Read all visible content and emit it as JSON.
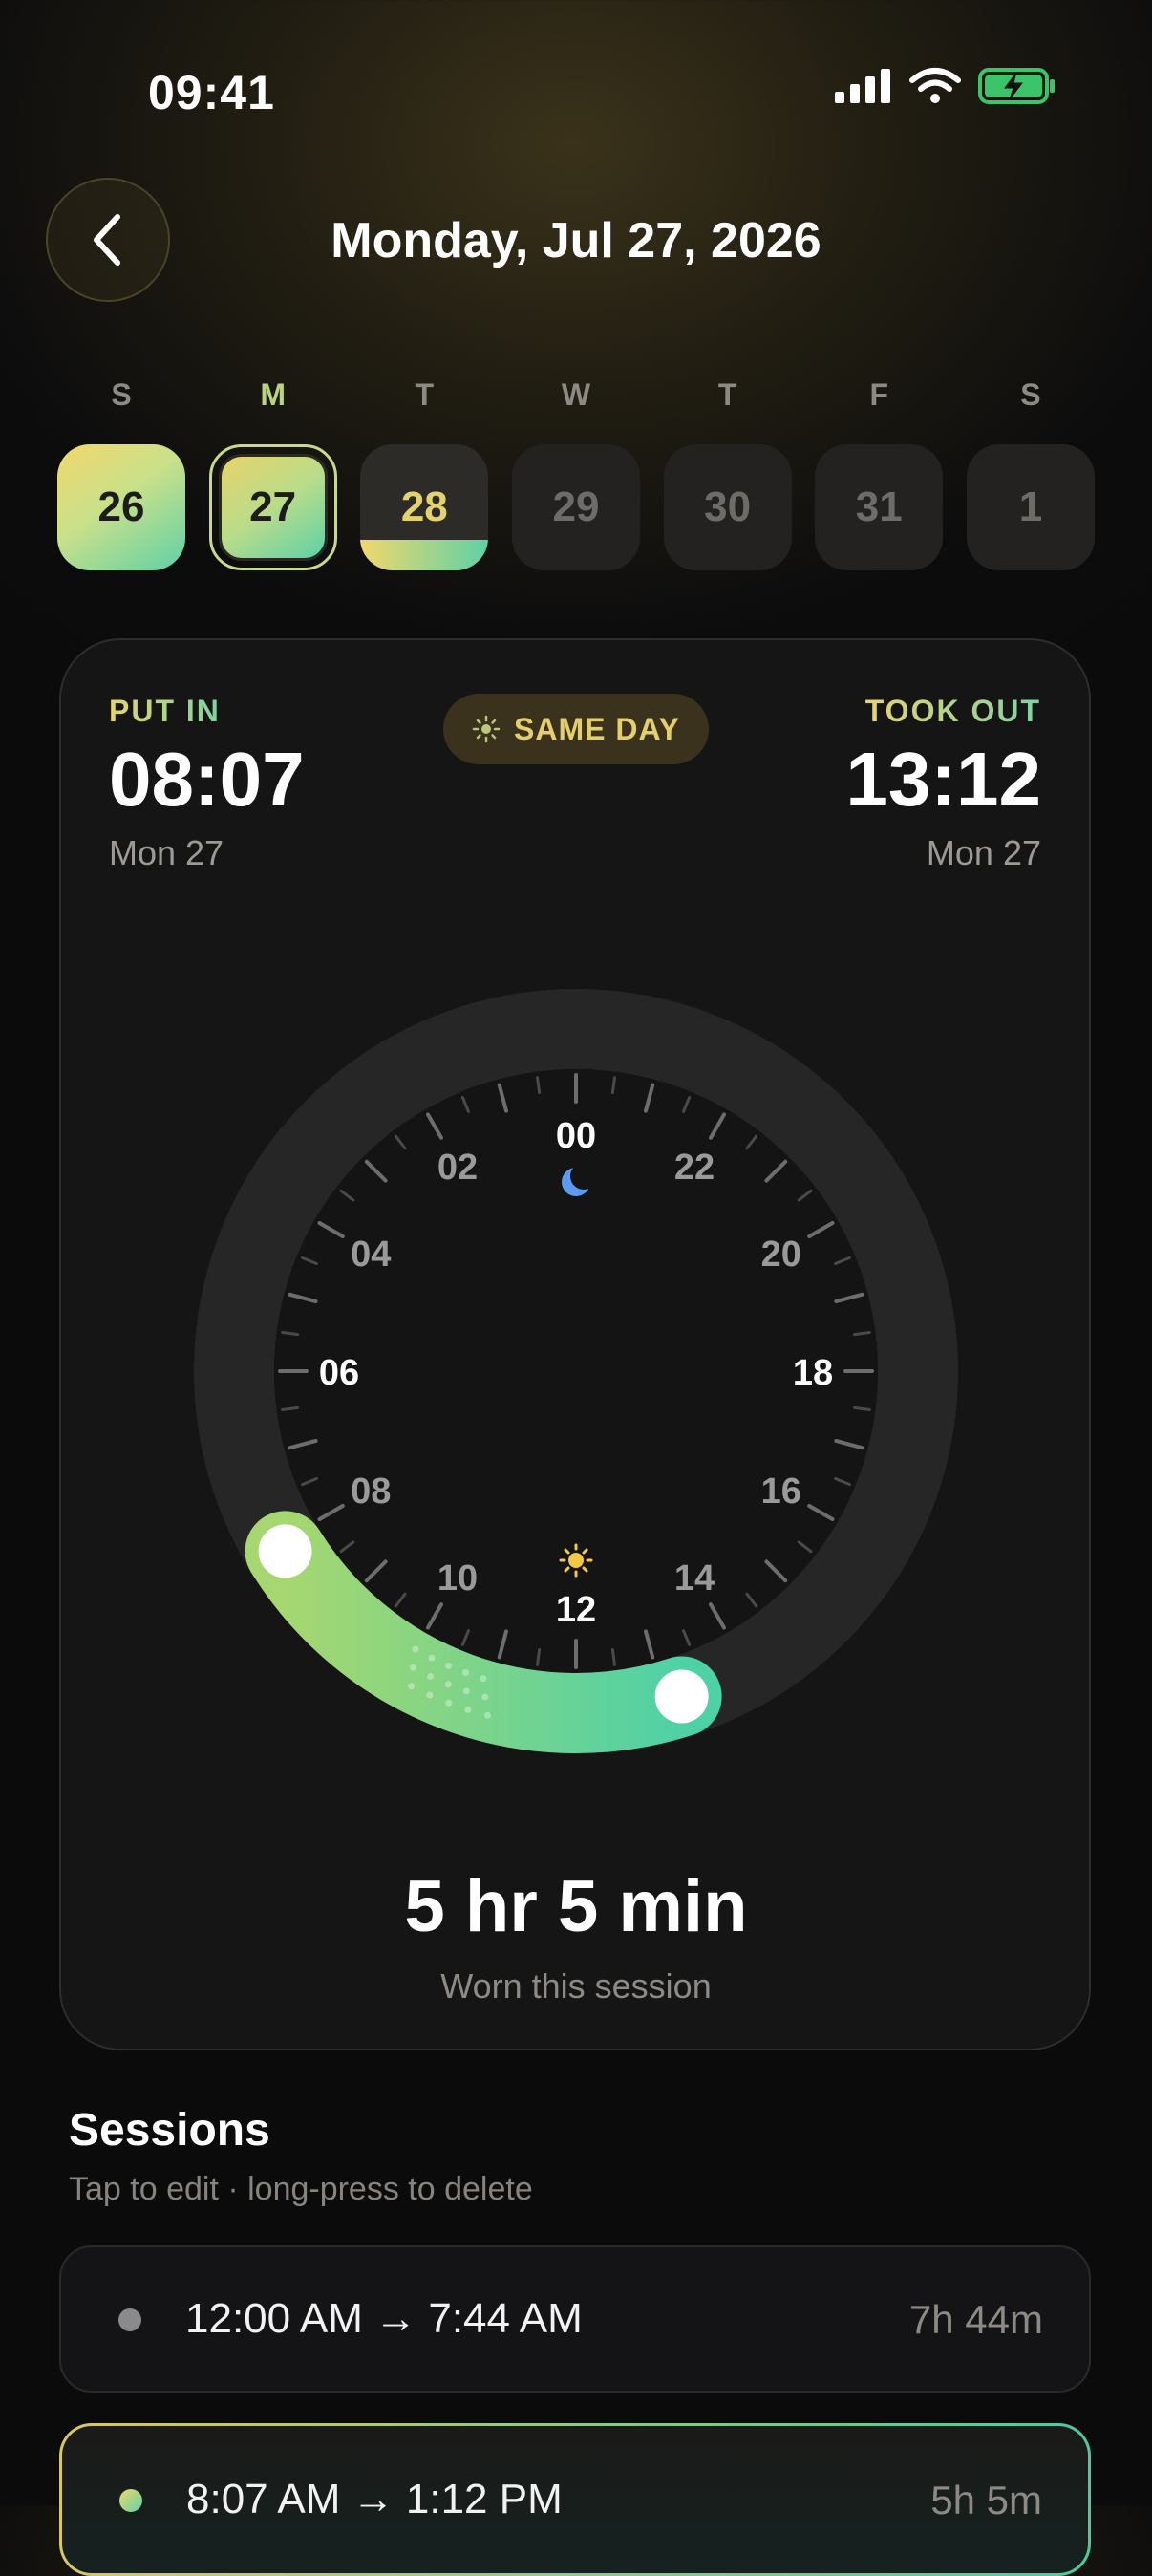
{
  "status_bar": {
    "time": "09:41"
  },
  "header": {
    "title": "Monday, Jul 27, 2026"
  },
  "week": [
    {
      "dow": "S",
      "day": "26"
    },
    {
      "dow": "M",
      "day": "27"
    },
    {
      "dow": "T",
      "day": "28"
    },
    {
      "dow": "W",
      "day": "29"
    },
    {
      "dow": "T",
      "day": "30"
    },
    {
      "dow": "F",
      "day": "31"
    },
    {
      "dow": "S",
      "day": "1"
    }
  ],
  "session_card": {
    "put_in_label": "PUT IN",
    "put_in_time": "08:07",
    "put_in_date": "Mon 27",
    "badge": "SAME DAY",
    "took_out_label": "TOOK OUT",
    "took_out_time": "13:12",
    "took_out_date": "Mon 27",
    "dial_hours": [
      "00",
      "02",
      "04",
      "06",
      "08",
      "10",
      "12",
      "14",
      "16",
      "18",
      "20",
      "22"
    ],
    "duration": "5 hr 5 min",
    "duration_caption": "Worn this session"
  },
  "sessions": {
    "title": "Sessions",
    "hint": "Tap to edit · long-press to delete",
    "rows": [
      {
        "range": "12:00 AM → 7:44 AM",
        "duration": "7h 44m"
      },
      {
        "range": "8:07 AM → 1:12 PM",
        "duration": "5h 5m"
      }
    ]
  },
  "colors": {
    "accent_yellow": "#f1d86c",
    "accent_green": "#5ed1a8",
    "moon": "#5b9cf0"
  }
}
